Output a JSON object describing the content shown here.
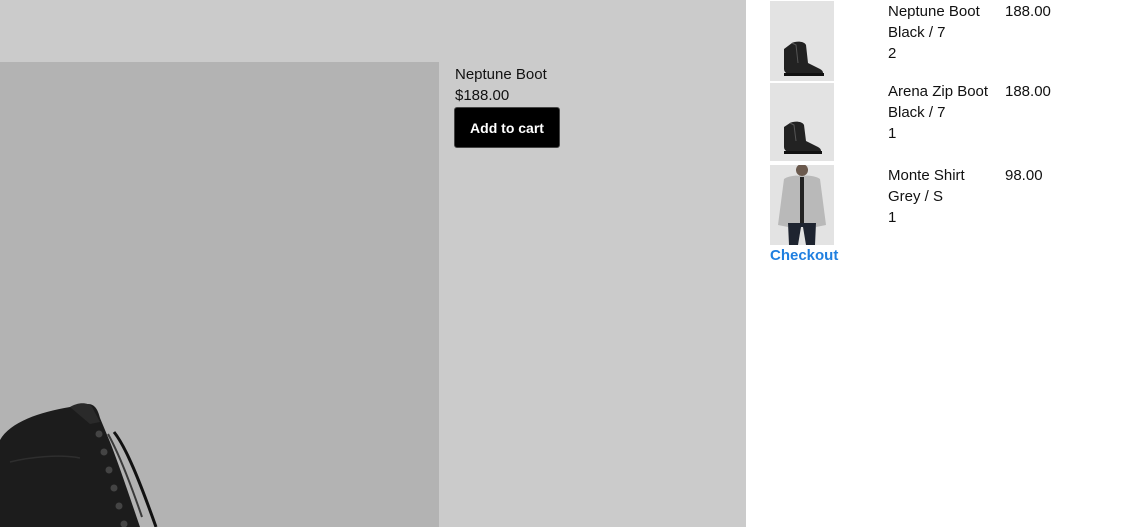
{
  "product": {
    "title": "Neptune Boot",
    "price": "$188.00",
    "add_to_cart_label": "Add to cart"
  },
  "cart": {
    "items": [
      {
        "name": "Neptune Boot",
        "variant": "Black / 7",
        "quantity": "2",
        "price": "188.00",
        "image_icon": "black-boot"
      },
      {
        "name": "Arena Zip Boot",
        "variant": "Black / 7",
        "quantity": "1",
        "price": "188.00",
        "image_icon": "black-zip-boot"
      },
      {
        "name": "Monte Shirt",
        "variant": "Grey / S",
        "quantity": "1",
        "price": "98.00",
        "image_icon": "grey-shirt-model"
      }
    ],
    "checkout_label": "Checkout"
  },
  "colors": {
    "product_background": "#cbcbcb",
    "image_background": "#b3b3b3",
    "button_background": "#000000",
    "link_color": "#1f7fe0"
  }
}
